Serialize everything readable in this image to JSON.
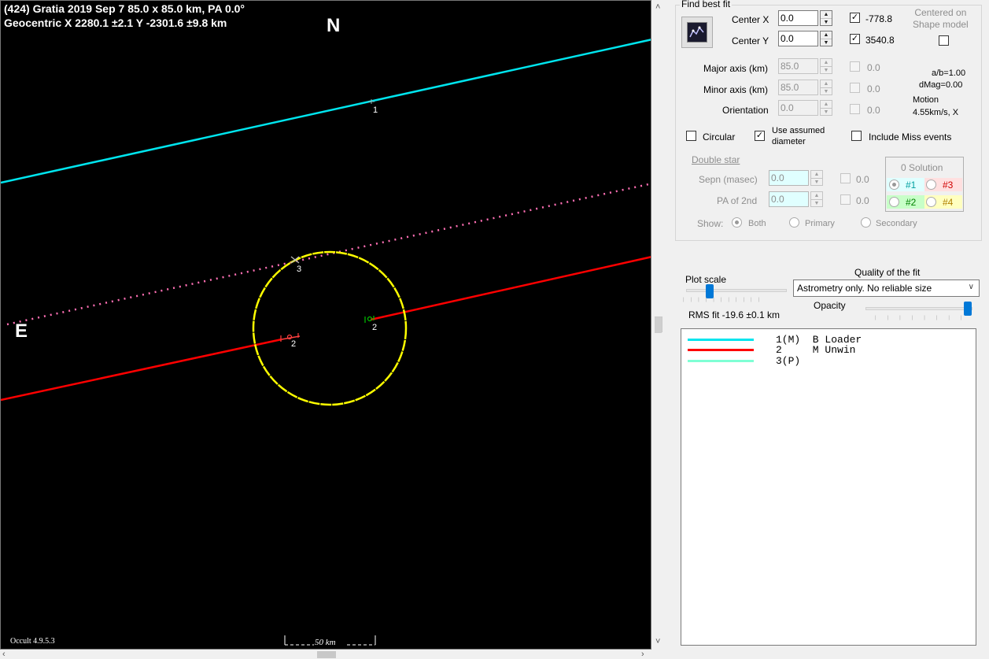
{
  "plot": {
    "title_line1": "(424) Gratia  2019 Sep 7   85.0 x 85.0 km,  PA 0.0°",
    "title_line2": "Geocentric  X  2280.1 ±2.1  Y -2301.6 ±9.8 km",
    "north": "N",
    "east": "E",
    "version": "Occult 4.9.5.3",
    "scale_bar": "50 km",
    "chord_labels": [
      "1",
      "3",
      "2",
      "2"
    ],
    "colors": {
      "chord1": "#00e5ee",
      "chord2": "#ff0000",
      "chord3": "#ff6fb4",
      "outline": "#ffff00",
      "background": "#000000"
    }
  },
  "panel": {
    "find_best_fit": "Find best fit",
    "center_x_label": "Center X",
    "center_x_value": "0.0",
    "center_x_check_value": "-778.8",
    "center_y_label": "Center Y",
    "center_y_value": "0.0",
    "center_y_check_value": "3540.8",
    "centered_on_shape": "Centered on\nShape model",
    "major_label": "Major axis (km)",
    "major_value": "85.0",
    "major_check_value": "0.0",
    "minor_label": "Minor axis (km)",
    "minor_value": "85.0",
    "minor_check_value": "0.0",
    "orient_label": "Orientation",
    "orient_value": "0.0",
    "orient_check_value": "0.0",
    "ab_ratio": "a/b=1.00",
    "dmag": "dMag=0.00",
    "motion_label": "Motion",
    "motion_value": "4.55km/s, X",
    "circular_label": "Circular",
    "use_assumed_label": "Use assumed\ndiameter",
    "include_miss_label": "Include Miss events",
    "double_star_label": "Double star",
    "sepn_label": "Sepn (masec)",
    "sepn_value": "0.0",
    "sepn_check_value": "0.0",
    "pa2_label": "PA of 2nd",
    "pa2_value": "0.0",
    "pa2_check_value": "0.0",
    "show_label": "Show:",
    "show_both": "Both",
    "show_primary": "Primary",
    "show_secondary": "Secondary",
    "solution_title": "0 Solution",
    "sol1": "#1",
    "sol2": "#2",
    "sol3": "#3",
    "sol4": "#4",
    "plot_scale_label": "Plot scale",
    "quality_label": "Quality of the fit",
    "quality_value": "Astrometry only. No reliable size",
    "opacity_label": "Opacity",
    "rms_fit": "RMS fit -19.6 ±0.1 km"
  },
  "legend": [
    {
      "text": "1(M)  B Loader",
      "color": "#00e5ee"
    },
    {
      "text": "2     M Unwin",
      "color": "#ff0000"
    },
    {
      "text": "3(P)",
      "color": "#7fffd4"
    }
  ]
}
